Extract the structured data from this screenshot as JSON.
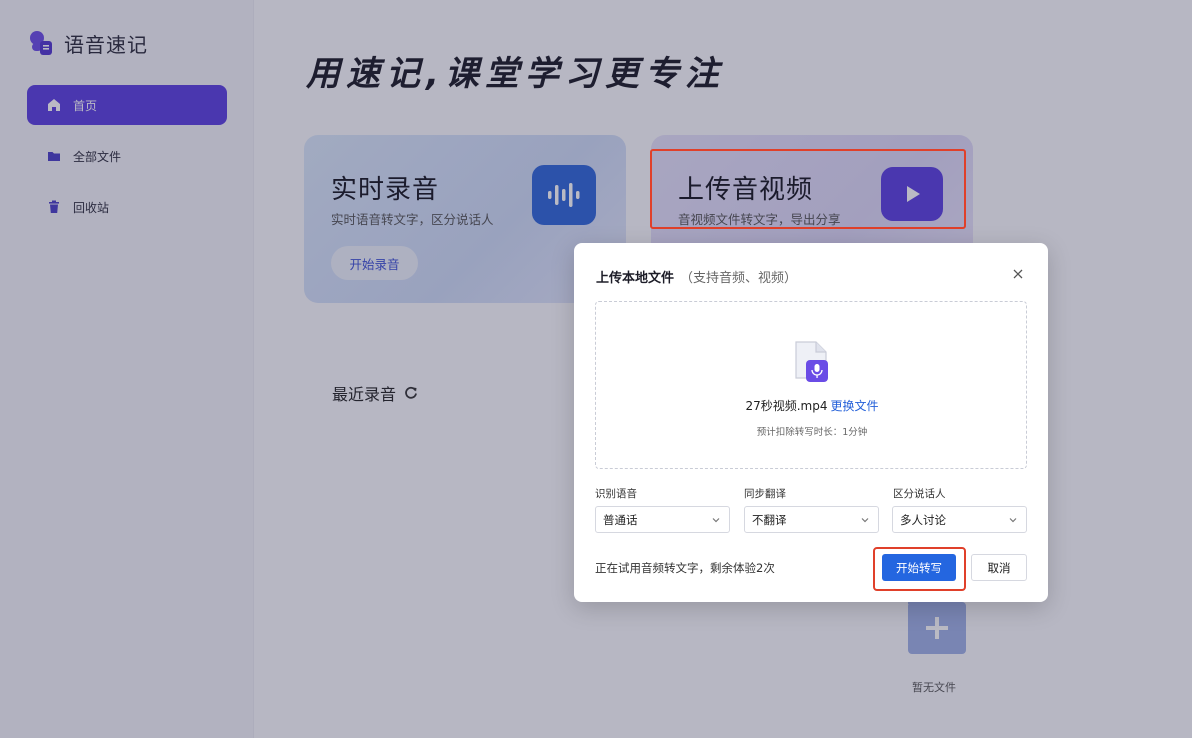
{
  "brand": {
    "name": "语音速记"
  },
  "sidebar": {
    "items": [
      {
        "label": "首页",
        "active": true,
        "icon": "home-icon"
      },
      {
        "label": "全部文件",
        "active": false,
        "icon": "folder-icon"
      },
      {
        "label": "回收站",
        "active": false,
        "icon": "trash-icon"
      }
    ]
  },
  "main": {
    "headline": "用速记,课堂学习更专注",
    "cards": {
      "record": {
        "title": "实时录音",
        "subtitle": "实时语音转文字，区分说话人",
        "button": "开始录音",
        "icon": "waveform-icon"
      },
      "upload": {
        "title": "上传音视频",
        "subtitle": "音视频文件转文字，导出分享",
        "icon": "video-folder-icon"
      }
    },
    "recent": {
      "label": "最近录音",
      "icon": "refresh-icon"
    },
    "empty": {
      "label": "暂无文件",
      "icon": "plus-icon"
    }
  },
  "dialog": {
    "title": "上传本地文件",
    "title_hint": "（支持音频、视频）",
    "file_name": "27秒视频.mp4",
    "change_file": "更换文件",
    "estimate": "预计扣除转写时长：1分钟",
    "fields": [
      {
        "label": "识别语音",
        "value": "普通话"
      },
      {
        "label": "同步翻译",
        "value": "不翻译"
      },
      {
        "label": "区分说话人",
        "value": "多人讨论"
      }
    ],
    "trial_text": "正在试用音频转文字，剩余体验2次",
    "primary_button": "开始转写",
    "cancel_button": "取消"
  },
  "colors": {
    "accent": "#5b3fe0",
    "primary": "#2466e0",
    "highlight": "#e0402a"
  }
}
